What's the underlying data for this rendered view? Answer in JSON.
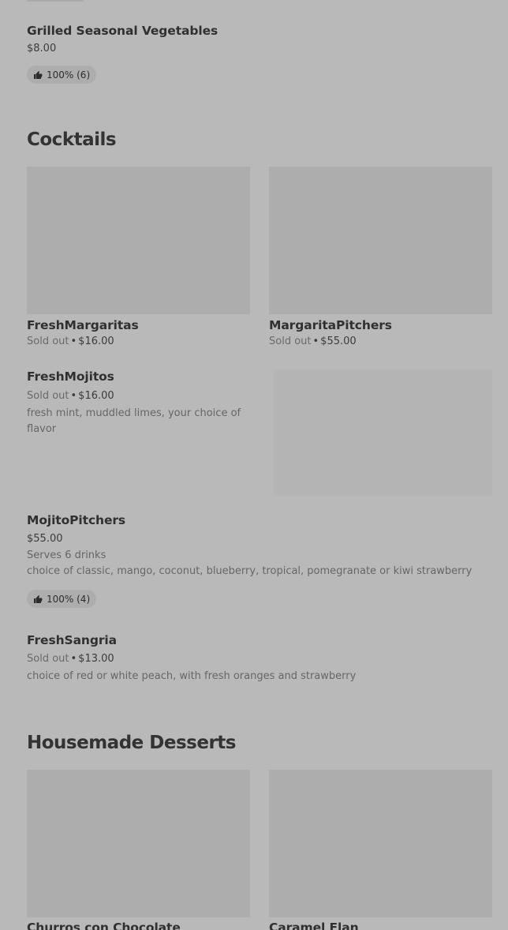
{
  "items_top": {
    "grilled_vegetables": {
      "name": "Grilled Seasonal Vegetables",
      "price": "$8.00",
      "rating": "100% (6)"
    }
  },
  "cocktails": {
    "title": "Cocktails",
    "fresh_margaritas": {
      "name": "FreshMargaritas",
      "status": "Sold out",
      "price": "$16.00"
    },
    "margarita_pitchers": {
      "name": "MargaritaPitchers",
      "status": "Sold out",
      "price": "$55.00"
    },
    "fresh_mojitos": {
      "name": "FreshMojitos",
      "status": "Sold out",
      "price": "$16.00",
      "description": "fresh mint, muddled limes, your choice of flavor"
    },
    "mojito_pitchers": {
      "name": "MojitoPitchers",
      "price": "$55.00",
      "serves": "Serves 6 drinks",
      "description": "choice of classic, mango, coconut, blueberry, tropical, pomegranate or kiwi strawberry",
      "rating": "100% (4)"
    },
    "fresh_sangria": {
      "name": "FreshSangria",
      "status": "Sold out",
      "price": "$13.00",
      "description": "choice of red or white peach, with fresh oranges and strawberry"
    }
  },
  "desserts": {
    "title": "Housemade Desserts",
    "churros": {
      "name": "Churros con Chocolate"
    },
    "caramel_flan": {
      "name": "Caramel Flan"
    }
  },
  "separator": "•",
  "icons": {
    "rating": "thumbs-up-icon"
  }
}
